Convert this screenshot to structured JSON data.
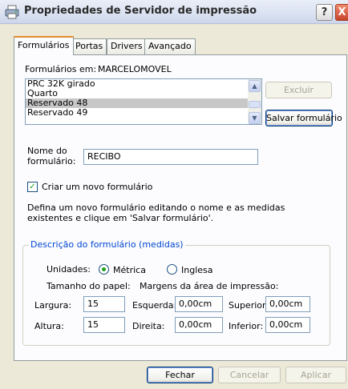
{
  "window": {
    "title": "Propriedades de Servidor de impressão",
    "help_icon": "?",
    "close_icon": "X"
  },
  "tabs": [
    {
      "label": "Formulários",
      "active": true
    },
    {
      "label": "Portas",
      "active": false
    },
    {
      "label": "Drivers",
      "active": false
    },
    {
      "label": "Avançado",
      "active": false
    }
  ],
  "forms_on": {
    "label": "Formulários em:",
    "server": "MARCELOMOVEL"
  },
  "form_list": {
    "items": [
      "PRC 32K girado",
      "Quarto",
      "Reservado 48",
      "Reservado 49"
    ],
    "selected": "Reservado 48"
  },
  "buttons": {
    "delete": "Excluir",
    "save_form": "Salvar formulário",
    "close": "Fechar",
    "cancel": "Cancelar",
    "apply": "Aplicar"
  },
  "form_name": {
    "label_line1": "Nome do",
    "label_line2": "formulário:",
    "value": "RECIBO"
  },
  "create_new": {
    "label": "Criar um novo formulário",
    "checked": true
  },
  "instructions": {
    "line1": "Defina um novo formulário editando o nome e as medidas",
    "line2": "existentes e clique em 'Salvar formulário'."
  },
  "measurements": {
    "group_title": "Descrição do formulário (medidas)",
    "units_label": "Unidades:",
    "metric": "Métrica",
    "english": "Inglesa",
    "units_selected": "Métrica",
    "paper_size_label": "Tamanho do papel:",
    "margins_label": "Margens da área de impressão:",
    "width_label": "Largura:",
    "width_value": "15",
    "height_label": "Altura:",
    "height_value": "15",
    "left_label": "Esquerda:",
    "left_value": "0,00cm",
    "right_label": "Direita:",
    "right_value": "0,00cm",
    "top_label": "Superior:",
    "top_value": "0,00cm",
    "bottom_label": "Inferior:",
    "bottom_value": "0,00cm"
  }
}
